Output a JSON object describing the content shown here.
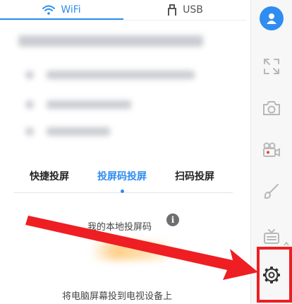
{
  "top_tabs": {
    "wifi_label": "WiFi",
    "usb_label": "USB",
    "active": "WiFi"
  },
  "mode_tabs": [
    {
      "label": "快捷投屏",
      "active": false
    },
    {
      "label": "投屏码投屏",
      "active": true
    },
    {
      "label": "扫码投屏",
      "active": false
    }
  ],
  "local_code": {
    "label": "我的本地投屏码",
    "info_icon": "i"
  },
  "footer_text": "将电脑屏幕投到电视设备上",
  "sidebar": {
    "buttons": [
      "avatar-icon",
      "fullscreen-icon",
      "camera-icon",
      "video-camera-icon",
      "brush-icon",
      "tv-icon",
      "settings-icon"
    ]
  },
  "colors": {
    "accent": "#2f8cf0",
    "annotation": "#ee1e23",
    "sidebar_bg": "#f7f7f7",
    "icon_gray": "#b6b8bb"
  }
}
